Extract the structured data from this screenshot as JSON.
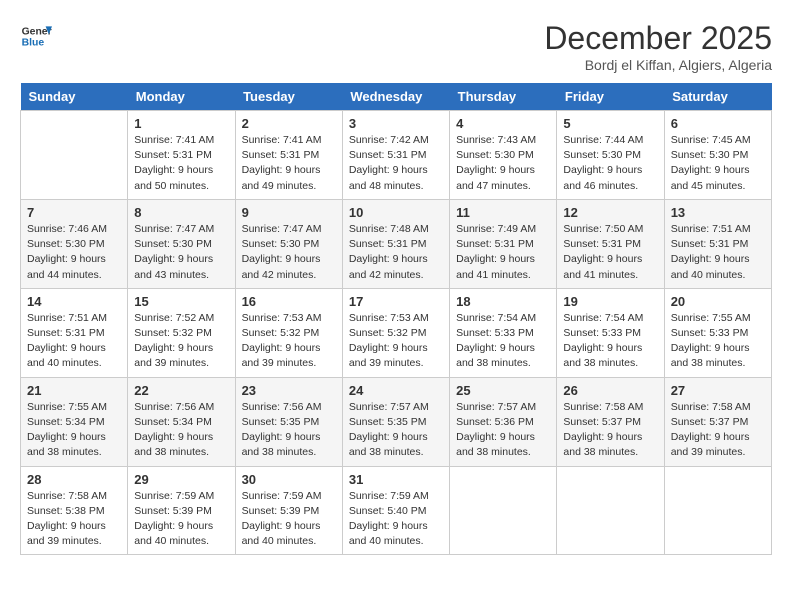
{
  "header": {
    "logo_line1": "General",
    "logo_line2": "Blue",
    "month": "December 2025",
    "location": "Bordj el Kiffan, Algiers, Algeria"
  },
  "days_of_week": [
    "Sunday",
    "Monday",
    "Tuesday",
    "Wednesday",
    "Thursday",
    "Friday",
    "Saturday"
  ],
  "weeks": [
    [
      {
        "day": "",
        "content": ""
      },
      {
        "day": "1",
        "content": "Sunrise: 7:41 AM\nSunset: 5:31 PM\nDaylight: 9 hours\nand 50 minutes."
      },
      {
        "day": "2",
        "content": "Sunrise: 7:41 AM\nSunset: 5:31 PM\nDaylight: 9 hours\nand 49 minutes."
      },
      {
        "day": "3",
        "content": "Sunrise: 7:42 AM\nSunset: 5:31 PM\nDaylight: 9 hours\nand 48 minutes."
      },
      {
        "day": "4",
        "content": "Sunrise: 7:43 AM\nSunset: 5:30 PM\nDaylight: 9 hours\nand 47 minutes."
      },
      {
        "day": "5",
        "content": "Sunrise: 7:44 AM\nSunset: 5:30 PM\nDaylight: 9 hours\nand 46 minutes."
      },
      {
        "day": "6",
        "content": "Sunrise: 7:45 AM\nSunset: 5:30 PM\nDaylight: 9 hours\nand 45 minutes."
      }
    ],
    [
      {
        "day": "7",
        "content": "Sunrise: 7:46 AM\nSunset: 5:30 PM\nDaylight: 9 hours\nand 44 minutes."
      },
      {
        "day": "8",
        "content": "Sunrise: 7:47 AM\nSunset: 5:30 PM\nDaylight: 9 hours\nand 43 minutes."
      },
      {
        "day": "9",
        "content": "Sunrise: 7:47 AM\nSunset: 5:30 PM\nDaylight: 9 hours\nand 42 minutes."
      },
      {
        "day": "10",
        "content": "Sunrise: 7:48 AM\nSunset: 5:31 PM\nDaylight: 9 hours\nand 42 minutes."
      },
      {
        "day": "11",
        "content": "Sunrise: 7:49 AM\nSunset: 5:31 PM\nDaylight: 9 hours\nand 41 minutes."
      },
      {
        "day": "12",
        "content": "Sunrise: 7:50 AM\nSunset: 5:31 PM\nDaylight: 9 hours\nand 41 minutes."
      },
      {
        "day": "13",
        "content": "Sunrise: 7:51 AM\nSunset: 5:31 PM\nDaylight: 9 hours\nand 40 minutes."
      }
    ],
    [
      {
        "day": "14",
        "content": "Sunrise: 7:51 AM\nSunset: 5:31 PM\nDaylight: 9 hours\nand 40 minutes."
      },
      {
        "day": "15",
        "content": "Sunrise: 7:52 AM\nSunset: 5:32 PM\nDaylight: 9 hours\nand 39 minutes."
      },
      {
        "day": "16",
        "content": "Sunrise: 7:53 AM\nSunset: 5:32 PM\nDaylight: 9 hours\nand 39 minutes."
      },
      {
        "day": "17",
        "content": "Sunrise: 7:53 AM\nSunset: 5:32 PM\nDaylight: 9 hours\nand 39 minutes."
      },
      {
        "day": "18",
        "content": "Sunrise: 7:54 AM\nSunset: 5:33 PM\nDaylight: 9 hours\nand 38 minutes."
      },
      {
        "day": "19",
        "content": "Sunrise: 7:54 AM\nSunset: 5:33 PM\nDaylight: 9 hours\nand 38 minutes."
      },
      {
        "day": "20",
        "content": "Sunrise: 7:55 AM\nSunset: 5:33 PM\nDaylight: 9 hours\nand 38 minutes."
      }
    ],
    [
      {
        "day": "21",
        "content": "Sunrise: 7:55 AM\nSunset: 5:34 PM\nDaylight: 9 hours\nand 38 minutes."
      },
      {
        "day": "22",
        "content": "Sunrise: 7:56 AM\nSunset: 5:34 PM\nDaylight: 9 hours\nand 38 minutes."
      },
      {
        "day": "23",
        "content": "Sunrise: 7:56 AM\nSunset: 5:35 PM\nDaylight: 9 hours\nand 38 minutes."
      },
      {
        "day": "24",
        "content": "Sunrise: 7:57 AM\nSunset: 5:35 PM\nDaylight: 9 hours\nand 38 minutes."
      },
      {
        "day": "25",
        "content": "Sunrise: 7:57 AM\nSunset: 5:36 PM\nDaylight: 9 hours\nand 38 minutes."
      },
      {
        "day": "26",
        "content": "Sunrise: 7:58 AM\nSunset: 5:37 PM\nDaylight: 9 hours\nand 38 minutes."
      },
      {
        "day": "27",
        "content": "Sunrise: 7:58 AM\nSunset: 5:37 PM\nDaylight: 9 hours\nand 39 minutes."
      }
    ],
    [
      {
        "day": "28",
        "content": "Sunrise: 7:58 AM\nSunset: 5:38 PM\nDaylight: 9 hours\nand 39 minutes."
      },
      {
        "day": "29",
        "content": "Sunrise: 7:59 AM\nSunset: 5:39 PM\nDaylight: 9 hours\nand 40 minutes."
      },
      {
        "day": "30",
        "content": "Sunrise: 7:59 AM\nSunset: 5:39 PM\nDaylight: 9 hours\nand 40 minutes."
      },
      {
        "day": "31",
        "content": "Sunrise: 7:59 AM\nSunset: 5:40 PM\nDaylight: 9 hours\nand 40 minutes."
      },
      {
        "day": "",
        "content": ""
      },
      {
        "day": "",
        "content": ""
      },
      {
        "day": "",
        "content": ""
      }
    ]
  ]
}
